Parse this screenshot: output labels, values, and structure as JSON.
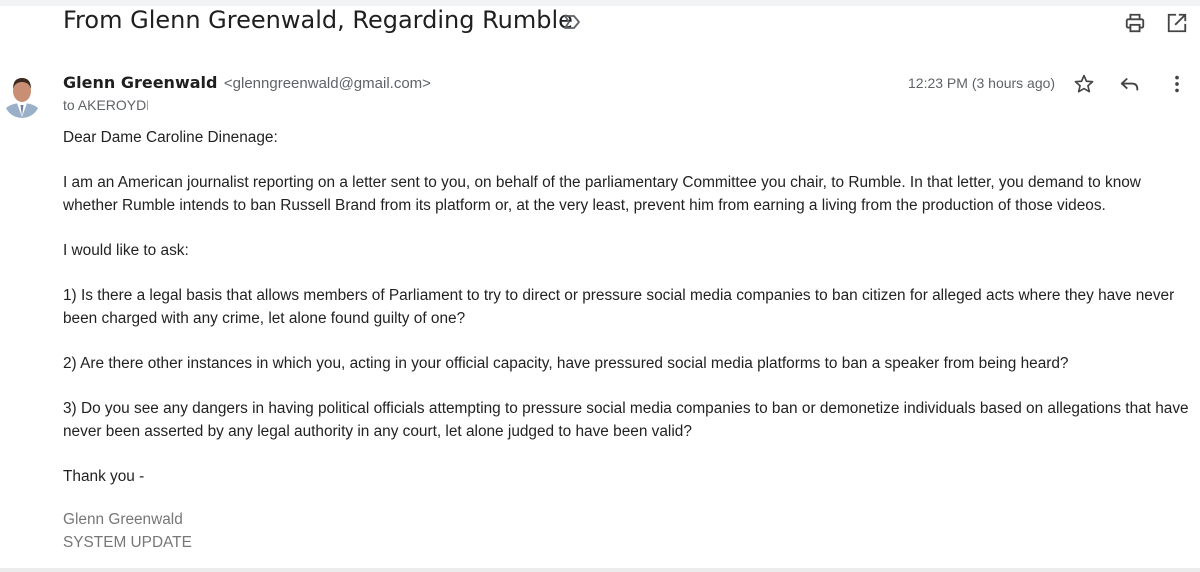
{
  "email": {
    "subject": "From Glenn Greenwald, Regarding Rumble",
    "sender_name": "Glenn Greenwald",
    "sender_email": "<glenngreenwald@gmail.com>",
    "recipient": "to AKEROYDF",
    "timestamp": "12:23 PM (3 hours ago)"
  },
  "body": {
    "greeting": "Dear Dame Caroline Dinenage:",
    "para1": "I am an American journalist reporting on a letter sent to you, on behalf of the parliamentary Committee you chair, to Rumble. In that letter, you demand to know whether Rumble intends to ban Russell Brand from its platform or, at the very least, prevent him from earning a living from the production of those videos.",
    "para2": "I would like to ask:",
    "q1": "1) Is there a legal basis that allows members of Parliament to try to direct or pressure social media companies to ban citizen for alleged acts where they have never been charged with any crime, let alone found guilty of one?",
    "q2": "2) Are there other instances in which you, acting in your official capacity, have pressured social media platforms to ban a speaker from being heard?",
    "q3": "3) Do you see any dangers in having political officials attempting to pressure social media companies to ban or demonetize individuals based on allegations that have never been asserted by any legal authority in any court, let alone judged to have been valid?",
    "closing": "Thank you -"
  },
  "signature": {
    "name": "Glenn Greenwald",
    "show": "SYSTEM UPDATE"
  },
  "icons": {
    "label": "label-icon",
    "print": "print-icon",
    "popout": "open-in-new-window-icon",
    "star": "star-icon",
    "reply": "reply-icon",
    "more": "more-vertical-icon"
  }
}
